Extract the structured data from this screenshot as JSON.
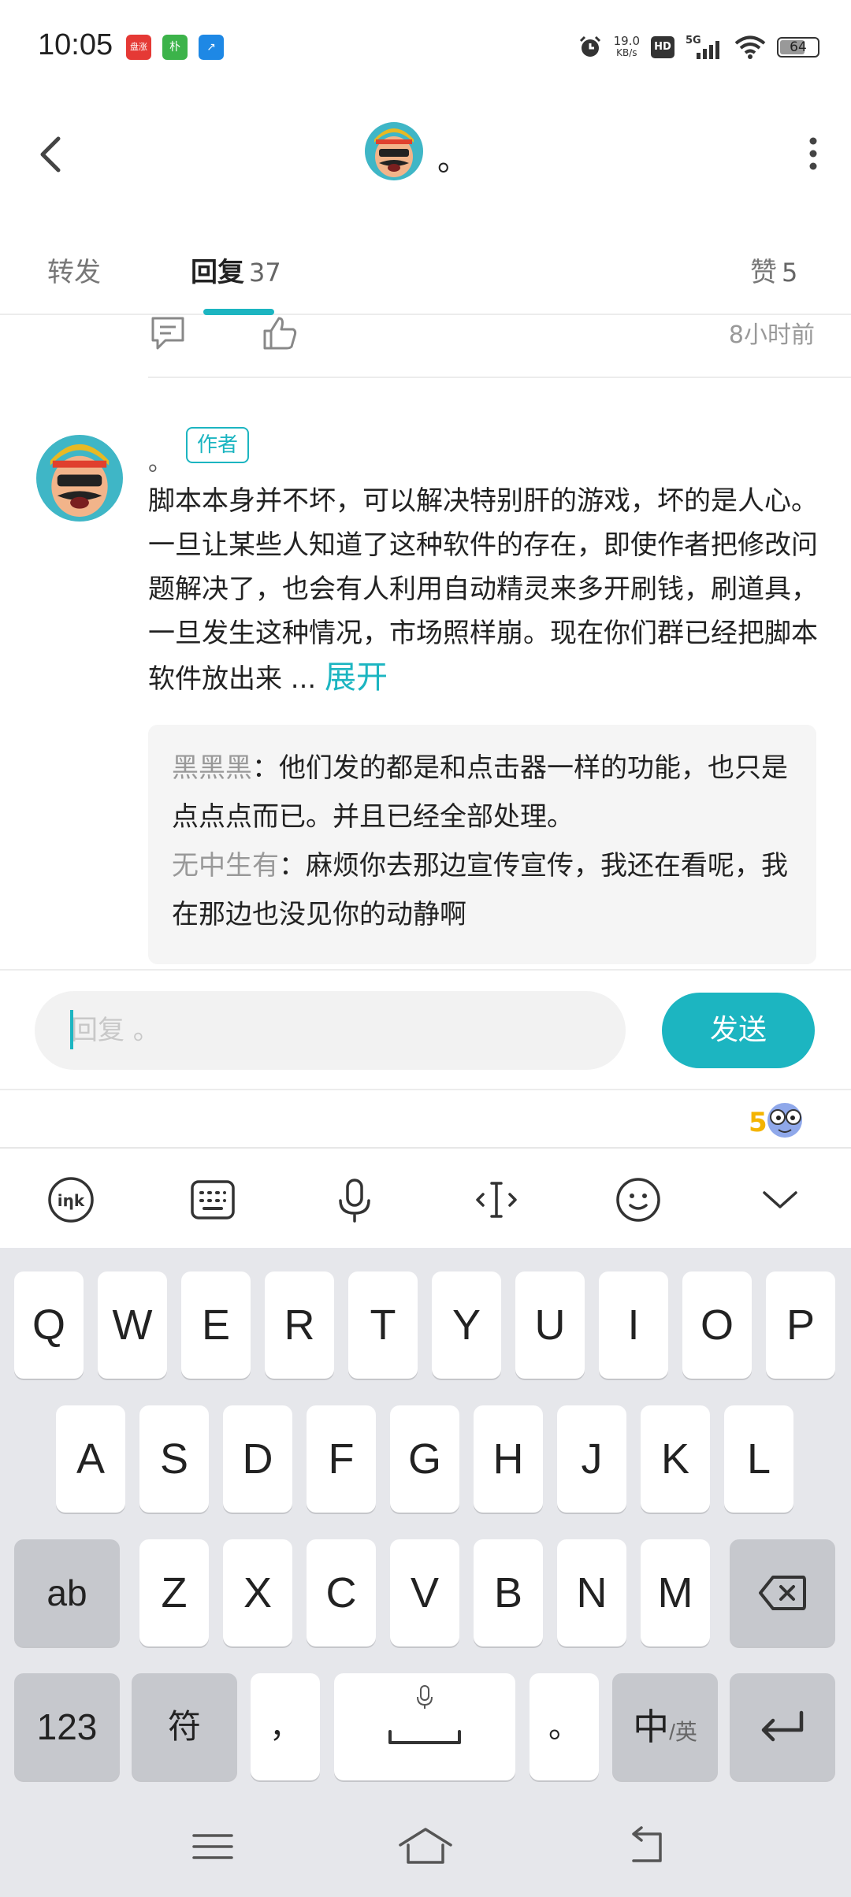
{
  "status_bar": {
    "time": "10:05",
    "app_icons": [
      {
        "name": "news-app-icon",
        "label": "盘涨",
        "color": "#e53935"
      },
      {
        "name": "wechat-app-icon",
        "label": "朴",
        "color": "#3cb34a"
      },
      {
        "name": "direction-app-icon",
        "label": "↗",
        "color": "#1e88e5"
      }
    ],
    "net_speed": "19.0",
    "net_unit": "KB/s",
    "hd": "HD",
    "signal_label": "5G",
    "battery": "64"
  },
  "header": {
    "title": "。"
  },
  "tabs": [
    {
      "label": "转发",
      "count": "",
      "active": false
    },
    {
      "label": "回复",
      "count": "37",
      "active": true
    },
    {
      "label": "赞",
      "count": "5",
      "active": false
    }
  ],
  "prev_comment": {
    "time": "8小时前"
  },
  "comment": {
    "name": "。",
    "badge": "作者",
    "body": "脚本本身并不坏，可以解决特别肝的游戏，坏的是人心。一旦让某些人知道了这种软件的存在，即使作者把修改问题解决了，也会有人利用自动精灵来多开刷钱，刷道具，一旦发生这种情况，市场照样崩。现在你们群已经把脚本软件放出来 ...",
    "expand": "展开",
    "replies": [
      {
        "name": "黑黑黑",
        "text": "：他们发的都是和点击器一样的功能，也只是点点点而已。并且已经全部处理。"
      },
      {
        "name": "无中生有",
        "text": "：麻烦你去那边宣传宣传，我还在看呢，我在那边也没见你的动静啊"
      }
    ]
  },
  "input": {
    "placeholder": "回复 。",
    "value": "",
    "send_label": "发送"
  },
  "keyboard": {
    "row1": [
      "Q",
      "W",
      "E",
      "R",
      "T",
      "Y",
      "U",
      "I",
      "O",
      "P"
    ],
    "row2": [
      "A",
      "S",
      "D",
      "F",
      "G",
      "H",
      "J",
      "K",
      "L"
    ],
    "row3": [
      "Z",
      "X",
      "C",
      "V",
      "B",
      "N",
      "M"
    ],
    "shift_label": "ab",
    "num_label": "123",
    "symbol_label": "符",
    "comma_label": "，",
    "period_label": "。",
    "lang_main": "中",
    "lang_sub": "/英"
  }
}
